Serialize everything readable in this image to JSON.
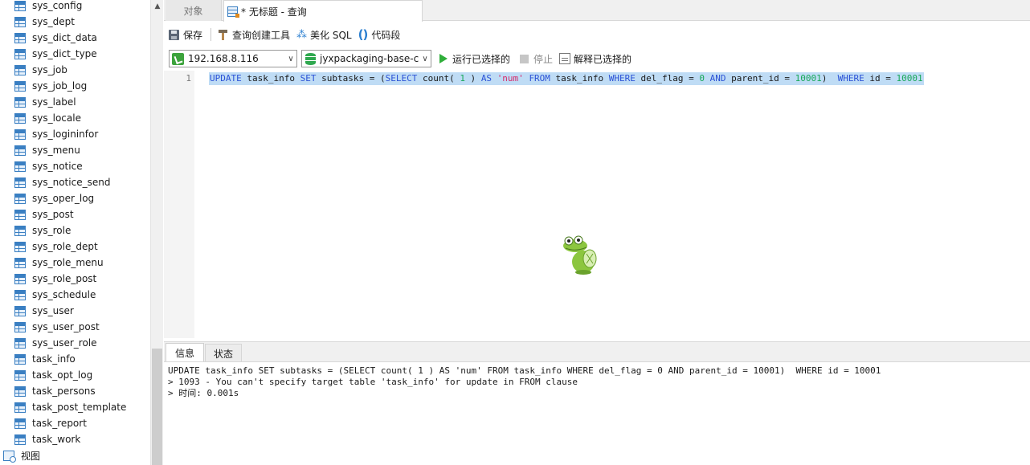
{
  "sidebar": {
    "tables": [
      "sys_config",
      "sys_dept",
      "sys_dict_data",
      "sys_dict_type",
      "sys_job",
      "sys_job_log",
      "sys_label",
      "sys_locale",
      "sys_logininfor",
      "sys_menu",
      "sys_notice",
      "sys_notice_send",
      "sys_oper_log",
      "sys_post",
      "sys_role",
      "sys_role_dept",
      "sys_role_menu",
      "sys_role_post",
      "sys_schedule",
      "sys_user",
      "sys_user_post",
      "sys_user_role",
      "task_info",
      "task_opt_log",
      "task_persons",
      "task_post_template",
      "task_report",
      "task_work"
    ],
    "views_label": "视图"
  },
  "tabs": {
    "objects": "对象",
    "query": "* 无标题 - 查询"
  },
  "toolbar": {
    "save": "保存",
    "query_builder": "查询创建工具",
    "beautify": "美化 SQL",
    "snippet": "代码段"
  },
  "connection": {
    "host": "192.168.8.116",
    "database": "jyxpackaging-base-c",
    "run_selected": "运行已选择的",
    "stop": "停止",
    "explain_selected": "解释已选择的"
  },
  "editor": {
    "line_number": "1",
    "tokens": [
      {
        "t": "UPDATE",
        "c": "kw"
      },
      {
        "t": " task_info ",
        "c": "pl"
      },
      {
        "t": "SET",
        "c": "kw"
      },
      {
        "t": " subtasks = (",
        "c": "pl"
      },
      {
        "t": "SELECT",
        "c": "kw"
      },
      {
        "t": " count( ",
        "c": "pl"
      },
      {
        "t": "1",
        "c": "num"
      },
      {
        "t": " ) ",
        "c": "pl"
      },
      {
        "t": "AS",
        "c": "kw"
      },
      {
        "t": " ",
        "c": "pl"
      },
      {
        "t": "'num'",
        "c": "str"
      },
      {
        "t": " ",
        "c": "pl"
      },
      {
        "t": "FROM",
        "c": "kw"
      },
      {
        "t": " task_info ",
        "c": "pl"
      },
      {
        "t": "WHERE",
        "c": "kw"
      },
      {
        "t": " del_flag = ",
        "c": "pl"
      },
      {
        "t": "0",
        "c": "num"
      },
      {
        "t": " ",
        "c": "pl"
      },
      {
        "t": "AND",
        "c": "kw"
      },
      {
        "t": " parent_id = ",
        "c": "pl"
      },
      {
        "t": "10001",
        "c": "num"
      },
      {
        "t": ")  ",
        "c": "pl"
      },
      {
        "t": "WHERE",
        "c": "kw"
      },
      {
        "t": " id = ",
        "c": "pl"
      },
      {
        "t": "10001",
        "c": "num"
      }
    ]
  },
  "result_tabs": {
    "info": "信息",
    "status": "状态"
  },
  "output": {
    "lines": [
      "UPDATE task_info SET subtasks = (SELECT count( 1 ) AS 'num' FROM task_info WHERE del_flag = 0 AND parent_id = 10001)  WHERE id = 10001",
      "> 1093 - You can't specify target table 'task_info' for update in FROM clause",
      "> 时间: 0.001s"
    ]
  },
  "colors": {
    "keyword": "#2b52d6",
    "number": "#1aa85a",
    "string": "#d62a6a",
    "selection": "#bfdcf5",
    "run": "#2fae3a"
  }
}
